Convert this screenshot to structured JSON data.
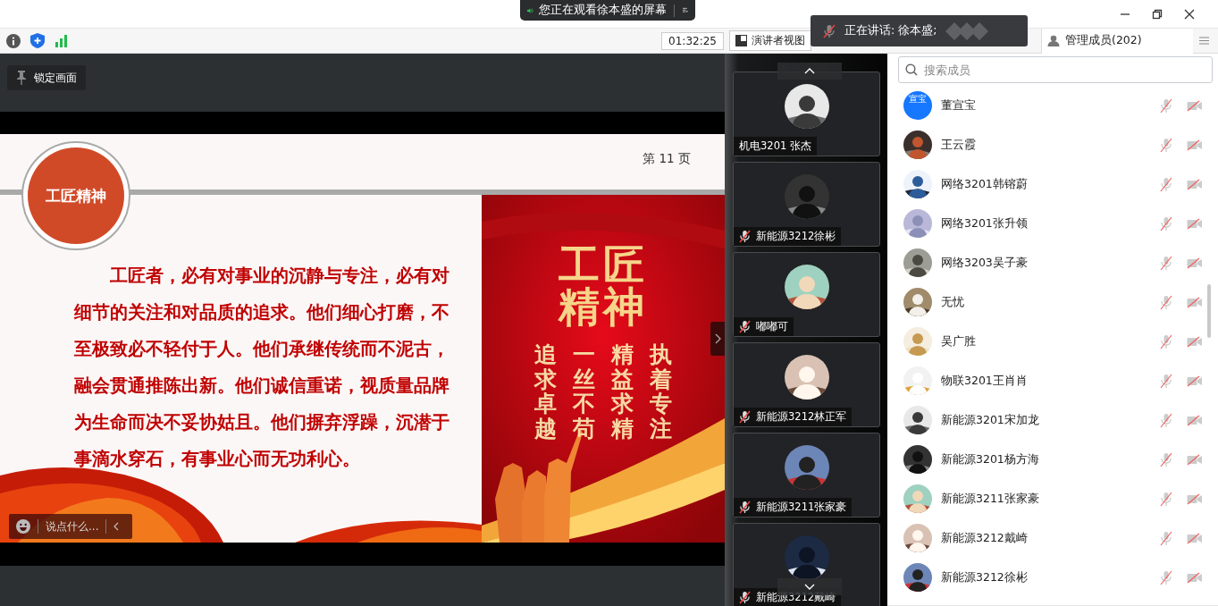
{
  "banner": {
    "text": "您正在观看徐本盛的屏幕"
  },
  "toolbar": {
    "timer": "01:32:25",
    "presenter_view": "演讲者视图",
    "manage_members": "管理成员(202)"
  },
  "speaking_toast": {
    "text": "正在讲话: 徐本盛;"
  },
  "shared_screen": {
    "lock_button": "锁定画面",
    "chat_placeholder": "说点什么...",
    "slide": {
      "badge": "工匠精神",
      "page": "第 11 页",
      "paragraph": "工匠者，必有对事业的沉静与专注，必有对细节的关注和对品质的追求。他们细心打磨，不至极致必不轻付于人。他们承继传统而不泥古，融会贯通推陈出新。他们诚信重诺，视质量品牌为生命而决不妥协姑且。他们摒弃浮躁，沉潜于事滴水穿石，有事业心而无功利心。",
      "poster": {
        "title_lines": [
          "工匠",
          "精神"
        ],
        "columns": [
          "追求卓越",
          "一丝不苟",
          "精益求精",
          "执着专注"
        ]
      }
    }
  },
  "video_tiles": [
    {
      "name": "机电3201 张杰",
      "muted": false
    },
    {
      "name": "新能源3212徐彬",
      "muted": true
    },
    {
      "name": "嘟嘟可",
      "muted": true
    },
    {
      "name": "新能源3212林正军",
      "muted": true
    },
    {
      "name": "新能源3211张家豪",
      "muted": true
    },
    {
      "name": "新能源3212戴崎",
      "muted": true
    }
  ],
  "members": {
    "search_placeholder": "搜索成员",
    "items": [
      {
        "name": "董宣宝",
        "kind": "initials",
        "initials": "宣宝",
        "mic_muted": true,
        "camera_off": true
      },
      {
        "name": "王云霞",
        "mic_muted": true,
        "camera_off": true
      },
      {
        "name": "网络3201韩镕蔚",
        "mic_muted": true,
        "camera_off": true
      },
      {
        "name": "网络3201张升领",
        "mic_muted": true,
        "camera_off": true
      },
      {
        "name": "网络3203吴子豪",
        "mic_muted": true,
        "camera_off": true
      },
      {
        "name": "无忧",
        "mic_muted": true,
        "camera_off": true
      },
      {
        "name": "吴广胜",
        "mic_muted": true,
        "camera_off": true
      },
      {
        "name": "物联3201王肖肖",
        "mic_muted": true,
        "camera_off": true
      },
      {
        "name": "新能源3201宋加龙",
        "mic_muted": true,
        "camera_off": true
      },
      {
        "name": "新能源3201杨方海",
        "mic_muted": true,
        "camera_off": true
      },
      {
        "name": "新能源3211张家豪",
        "mic_muted": true,
        "camera_off": true
      },
      {
        "name": "新能源3212戴崎",
        "mic_muted": true,
        "camera_off": true
      },
      {
        "name": "新能源3212徐彬",
        "mic_muted": true,
        "camera_off": true
      }
    ]
  }
}
